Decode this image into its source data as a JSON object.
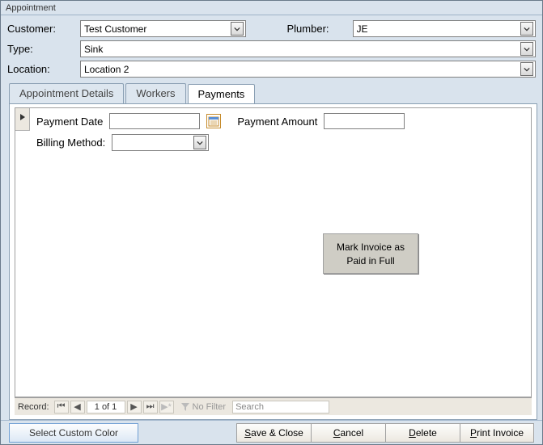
{
  "window": {
    "title": "Appointment"
  },
  "header": {
    "customer_label": "Customer:",
    "customer_value": "Test Customer",
    "plumber_label": "Plumber:",
    "plumber_value": "JE",
    "type_label": "Type:",
    "type_value": "Sink",
    "location_label": "Location:",
    "location_value": "Location 2"
  },
  "tabs": {
    "appt": "Appointment Details",
    "workers": "Workers",
    "payments": "Payments"
  },
  "payments": {
    "date_label": "Payment Date",
    "date_value": "",
    "amount_label": "Payment Amount",
    "amount_value": "",
    "billing_label": "Billing Method:",
    "billing_value": "",
    "mark_paid_line1": "Mark Invoice as",
    "mark_paid_line2": "Paid in Full"
  },
  "recordnav": {
    "label": "Record:",
    "counter": "1 of 1",
    "no_filter": "No Filter",
    "search_placeholder": "Search"
  },
  "bottom": {
    "color": "Select Custom Color",
    "save": "Save & Close",
    "cancel": "Cancel",
    "delete": "Delete",
    "print": "Print Invoice"
  }
}
